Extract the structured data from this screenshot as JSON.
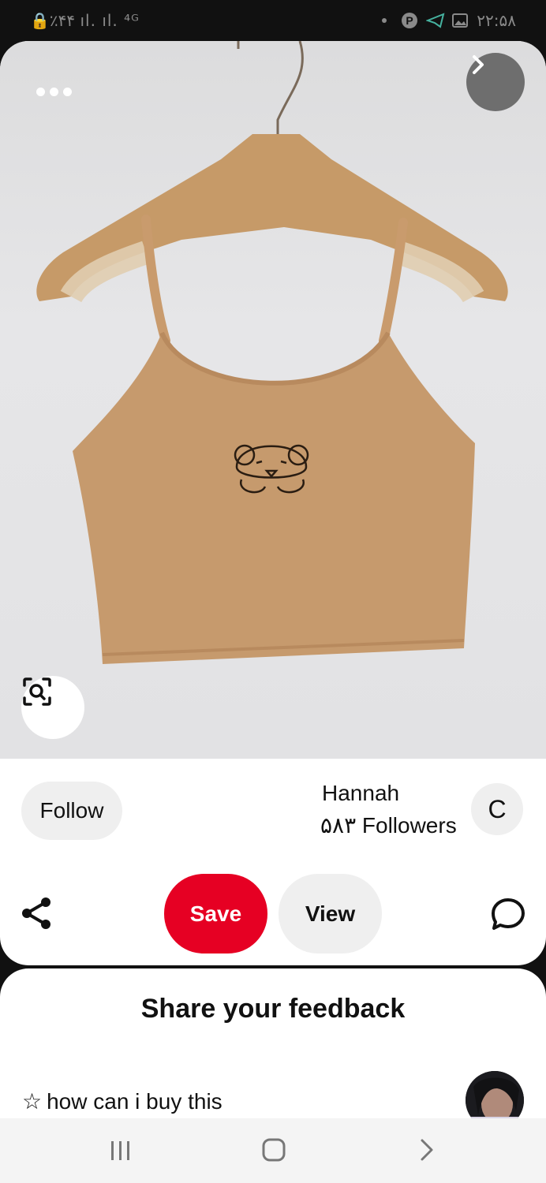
{
  "status_bar": {
    "left_text": "🔒٪۴۴ ıl. ıl. ⁴ᴳ",
    "time": "۲۲:۵۸",
    "icons": [
      "lock-icon",
      "signal-icon",
      "4g-icon",
      "key-icon",
      "dot-icon",
      "pinterest-icon",
      "telegram-icon",
      "gallery-icon"
    ]
  },
  "pin": {
    "image_subject": "top-image",
    "more_icon": "more-dots-icon",
    "next_icon": "chevron-right-icon",
    "lens_icon": "visual-search-icon"
  },
  "creator": {
    "follow_label": "Follow",
    "name": "Hannah",
    "followers": "۵۸۳ Followers",
    "avatar_letter": "C"
  },
  "actions": {
    "share_icon": "share-icon",
    "save_label": "Save",
    "view_label": "View",
    "comment_icon": "comment-icon"
  },
  "feedback": {
    "title": "Share your feedback",
    "option_star": "☆",
    "option_text": "how can i buy this"
  },
  "nav": {
    "icons": [
      "recents-icon",
      "home-icon",
      "back-icon"
    ]
  },
  "colors": {
    "save": "#e60023",
    "pill": "#efefef",
    "garment": "#c69a6d"
  }
}
